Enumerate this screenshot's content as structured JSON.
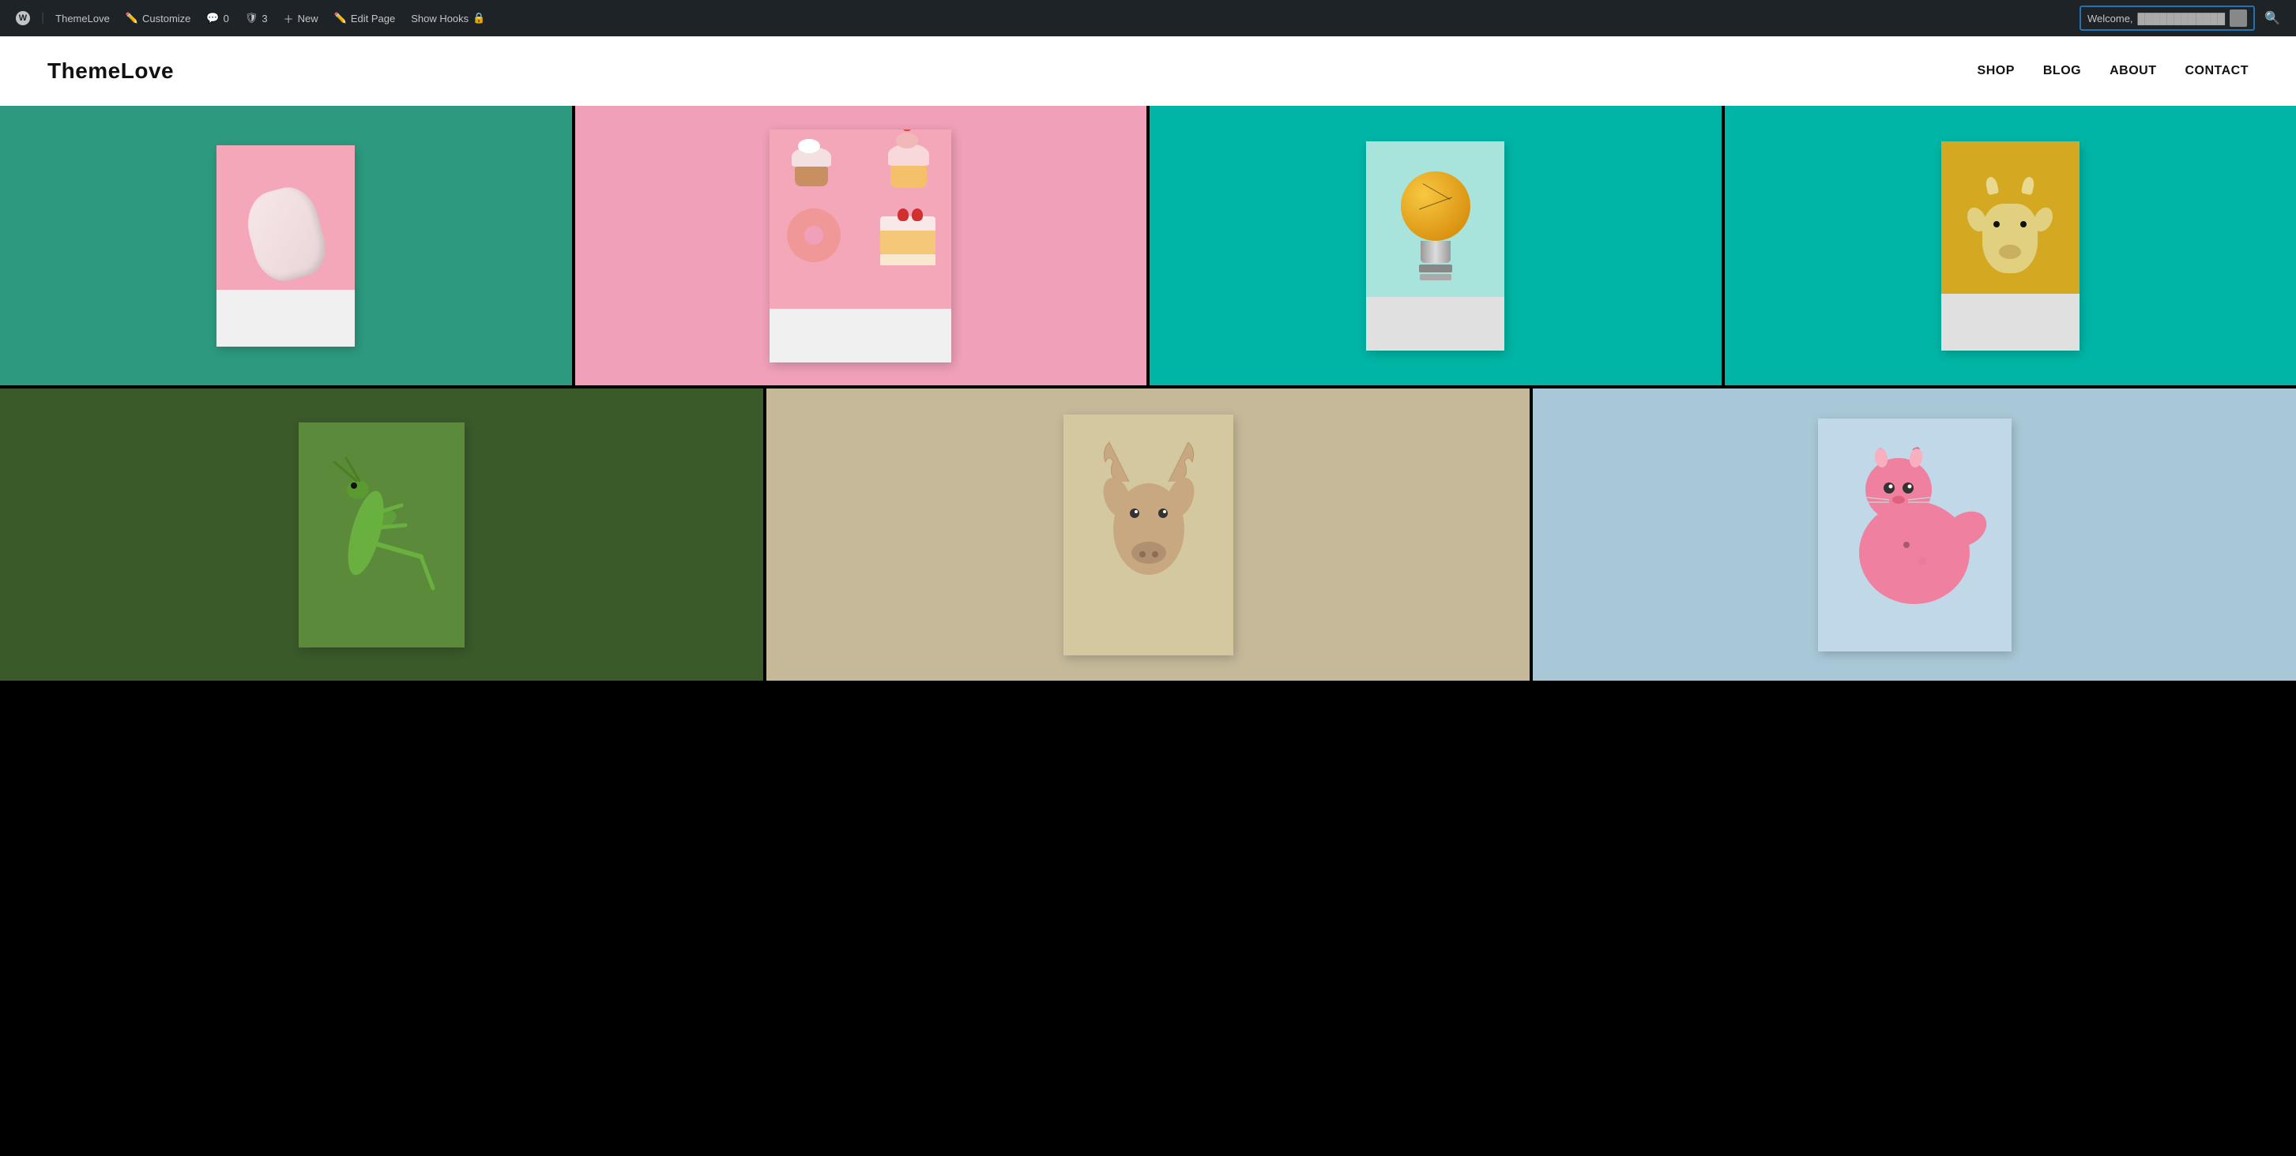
{
  "adminBar": {
    "wpLabel": "W",
    "themelove": "ThemeLove",
    "customize": "Customize",
    "comments": "0",
    "security": "3",
    "new": "New",
    "editPage": "Edit Page",
    "showHooks": "Show Hooks",
    "welcome": "Welcome,",
    "searchPlaceholder": "Search"
  },
  "siteHeader": {
    "title": "ThemeLove",
    "nav": {
      "shop": "SHOP",
      "blog": "BLOG",
      "about": "ABOUT",
      "contact": "CONTACT"
    }
  },
  "gallery": {
    "rows": [
      {
        "cells": [
          {
            "id": "cell-1",
            "bgColor": "#2d9a7f",
            "label": "marshmallow"
          },
          {
            "id": "cell-2",
            "bgColor": "#f4a7b9",
            "label": "sweets"
          },
          {
            "id": "cell-3",
            "bgColor": "#00b5a5",
            "label": "lightbulb"
          },
          {
            "id": "cell-4",
            "bgColor": "#00b5a5",
            "label": "goat"
          }
        ]
      },
      {
        "cells": [
          {
            "id": "cell-5",
            "bgColor": "#3a5a2a",
            "label": "grasshopper"
          },
          {
            "id": "cell-6",
            "bgColor": "#c5b99a",
            "label": "deer"
          },
          {
            "id": "cell-7",
            "bgColor": "#a8c8d8",
            "label": "llama"
          }
        ]
      }
    ]
  }
}
